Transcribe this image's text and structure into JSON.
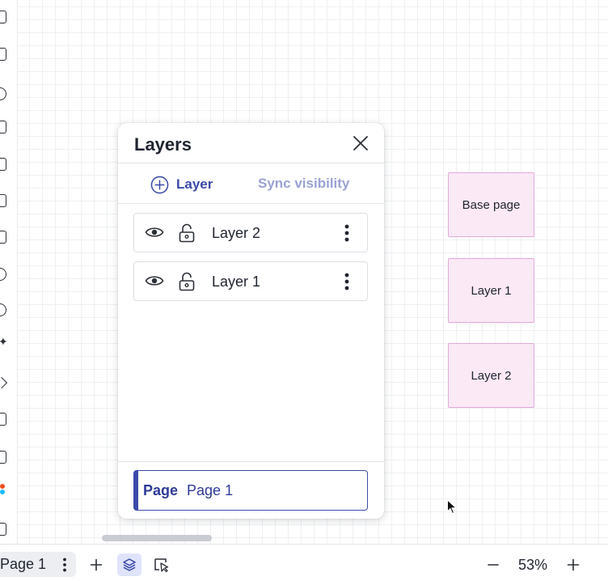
{
  "panel": {
    "title": "Layers",
    "add_layer_label": "Layer",
    "sync_label": "Sync visibility",
    "layers": [
      {
        "name": "Layer 2"
      },
      {
        "name": "Layer 1"
      }
    ],
    "page_selector": {
      "label": "Page",
      "value": "Page 1"
    }
  },
  "canvas": {
    "cards": [
      "Base page",
      "Layer 1",
      "Layer 2"
    ]
  },
  "bottom_bar": {
    "page_tab": "Page 1",
    "zoom": "53%"
  },
  "colors": {
    "accent": "#3b4aa8",
    "accent_light": "#9aa2d4",
    "card_fill": "#fbe9f6",
    "card_border": "#e2a9d8"
  }
}
